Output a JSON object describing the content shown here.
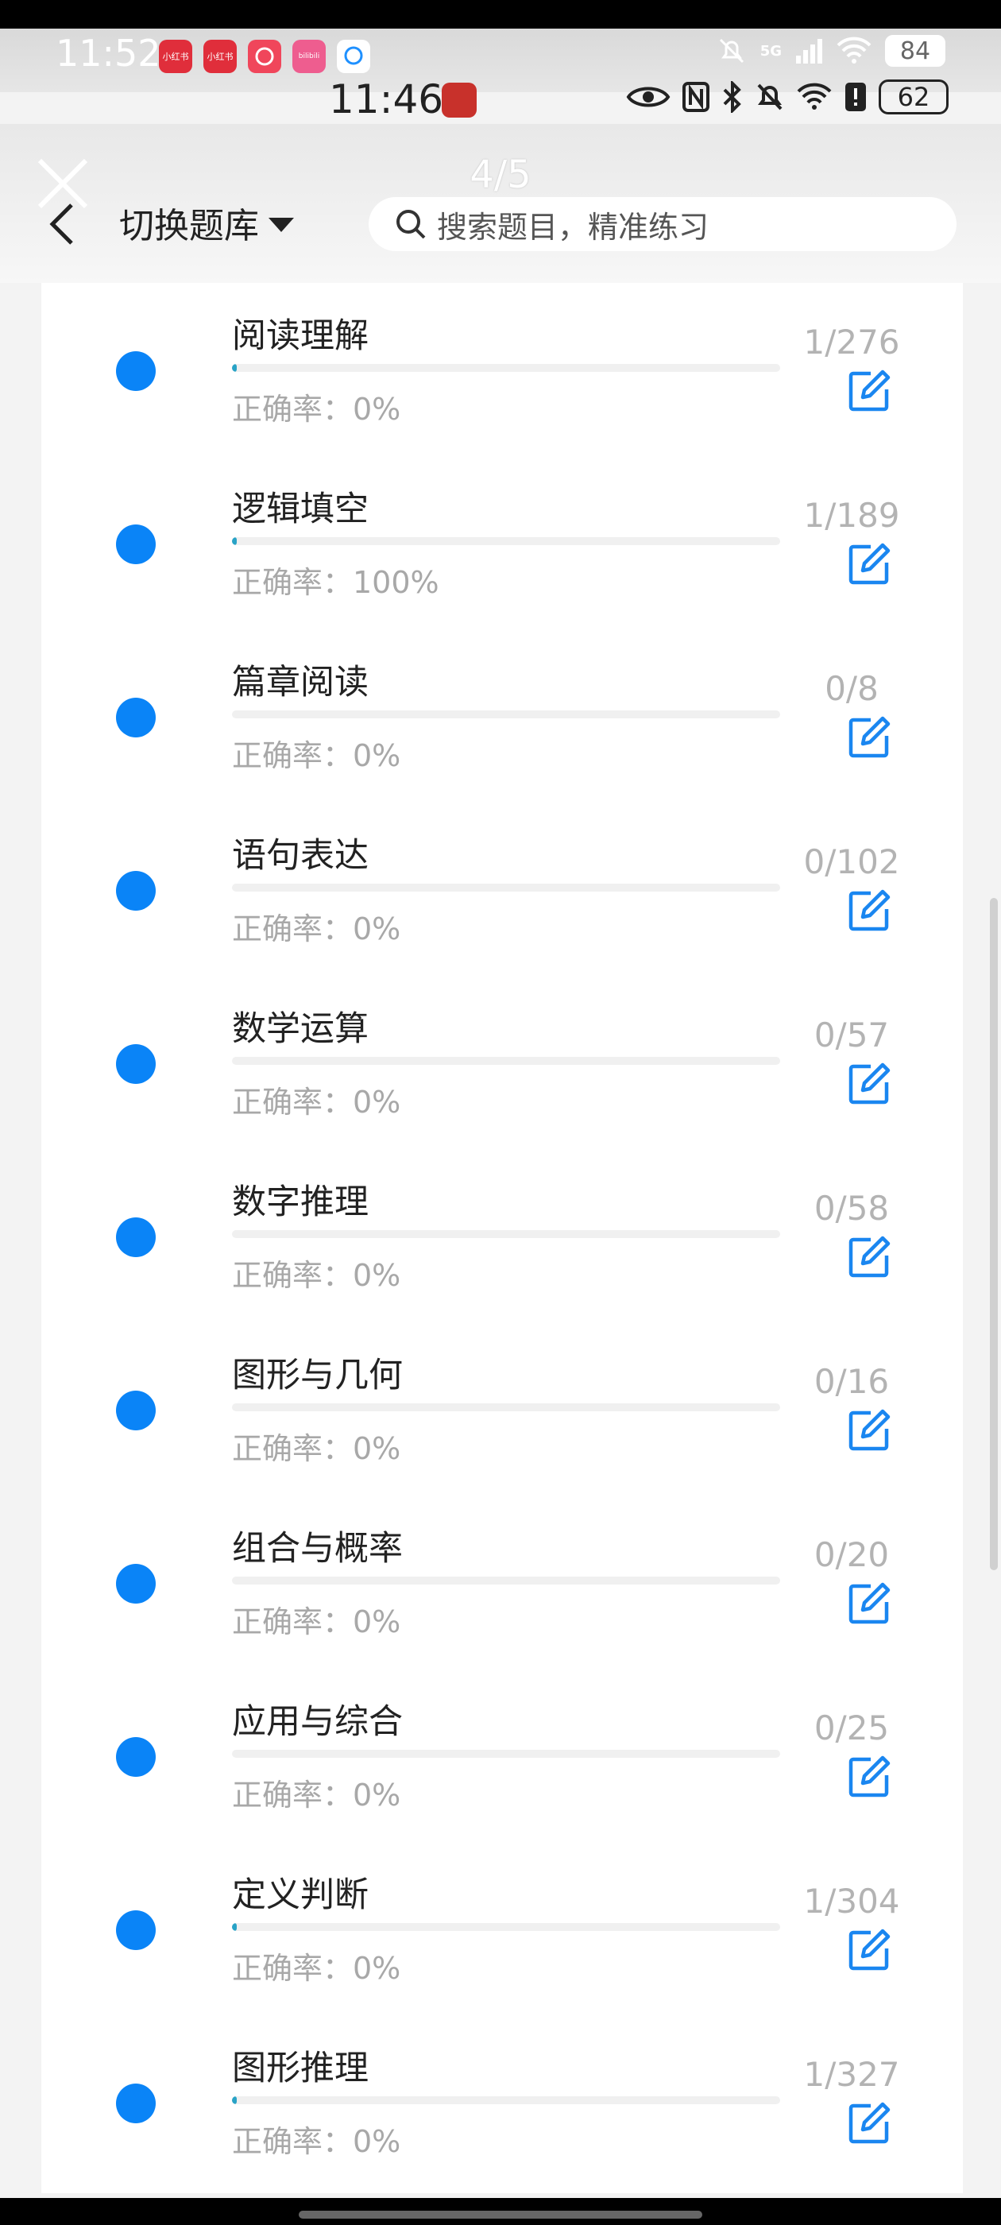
{
  "status_bar": {
    "time": "11:52",
    "battery": "84",
    "network": "5G",
    "apps": [
      {
        "label": "小红书",
        "color": "#e02e3b"
      },
      {
        "label": "小红书",
        "color": "#e02e3b"
      },
      {
        "label": "",
        "color": "#f0465b"
      },
      {
        "label": "bilibili",
        "color": "#ee5d8f"
      },
      {
        "label": "",
        "color": "#ffffff"
      }
    ]
  },
  "inner_status": {
    "time": "11:46",
    "battery": "62"
  },
  "header": {
    "counter": "4/5",
    "switch_label": "切换题库",
    "search_placeholder": "搜索题目，精准练习"
  },
  "colors": {
    "accent": "#0a84f7",
    "progress": "#29a3c6"
  },
  "items": [
    {
      "title": "阅读理解",
      "rate": "正确率：0%",
      "count": "1/276",
      "progress": 0.0036
    },
    {
      "title": "逻辑填空",
      "rate": "正确率：100%",
      "count": "1/189",
      "progress": 0.0053
    },
    {
      "title": "篇章阅读",
      "rate": "正确率：0%",
      "count": "0/8",
      "progress": 0
    },
    {
      "title": "语句表达",
      "rate": "正确率：0%",
      "count": "0/102",
      "progress": 0
    },
    {
      "title": "数学运算",
      "rate": "正确率：0%",
      "count": "0/57",
      "progress": 0
    },
    {
      "title": "数字推理",
      "rate": "正确率：0%",
      "count": "0/58",
      "progress": 0
    },
    {
      "title": "图形与几何",
      "rate": "正确率：0%",
      "count": "0/16",
      "progress": 0
    },
    {
      "title": "组合与概率",
      "rate": "正确率：0%",
      "count": "0/20",
      "progress": 0
    },
    {
      "title": "应用与综合",
      "rate": "正确率：0%",
      "count": "0/25",
      "progress": 0
    },
    {
      "title": "定义判断",
      "rate": "正确率：0%",
      "count": "1/304",
      "progress": 0.0033
    },
    {
      "title": "图形推理",
      "rate": "正确率：0%",
      "count": "1/327",
      "progress": 0.0031
    }
  ]
}
